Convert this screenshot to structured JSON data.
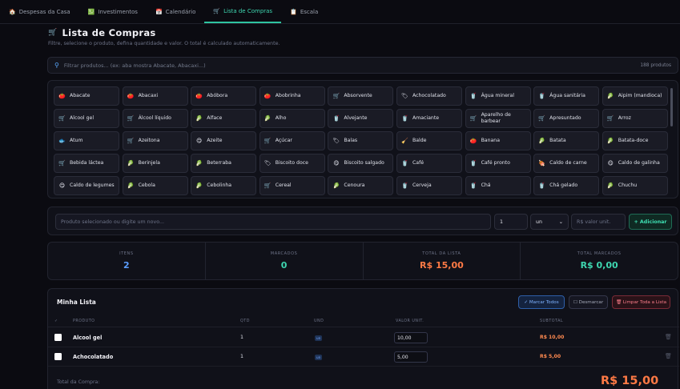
{
  "tabs": [
    {
      "icon": "🏠",
      "label": "Despesas da Casa",
      "active": false
    },
    {
      "icon": "💹",
      "label": "Investimentos",
      "active": false
    },
    {
      "icon": "📅",
      "label": "Calendário",
      "active": false
    },
    {
      "icon": "🛒",
      "label": "Lista de Compras",
      "active": true
    },
    {
      "icon": "📋",
      "label": "Escala",
      "active": false
    }
  ],
  "header": {
    "icon": "🛒",
    "title": "Lista de Compras",
    "subtitle": "Filtre, selecione o produto, defina quantidade e valor. O total é calculado automaticamente."
  },
  "search": {
    "placeholder": "Filtrar produtos... (ex: aba mostra Abacate, Abacaxi...)",
    "count": "188 produtos"
  },
  "products": [
    {
      "icon": "🍅",
      "label": "Abacate"
    },
    {
      "icon": "🍅",
      "label": "Abacaxi"
    },
    {
      "icon": "🍅",
      "label": "Abóbora"
    },
    {
      "icon": "🍅",
      "label": "Abobrinha"
    },
    {
      "icon": "🛒",
      "label": "Absorvente"
    },
    {
      "icon": "🏷",
      "label": "Achocolatado"
    },
    {
      "icon": "🥤",
      "label": "Água mineral"
    },
    {
      "icon": "🥤",
      "label": "Água sanitária"
    },
    {
      "icon": "🥬",
      "label": "Aipim (mandioca)"
    },
    {
      "icon": "🛒",
      "label": "Alcool gel"
    },
    {
      "icon": "🛒",
      "label": "Álcool líquido"
    },
    {
      "icon": "🥬",
      "label": "Alface"
    },
    {
      "icon": "🥬",
      "label": "Alho"
    },
    {
      "icon": "🥤",
      "label": "Alvejante"
    },
    {
      "icon": "🥤",
      "label": "Amaciante"
    },
    {
      "icon": "🛒",
      "label": "Aparelho de barbear"
    },
    {
      "icon": "🛒",
      "label": "Apresuntado"
    },
    {
      "icon": "🛒",
      "label": "Arroz"
    },
    {
      "icon": "🐟",
      "label": "Atum"
    },
    {
      "icon": "🛒",
      "label": "Azeitona"
    },
    {
      "icon": "😋",
      "label": "Azeite"
    },
    {
      "icon": "🛒",
      "label": "Açúcar"
    },
    {
      "icon": "🏷",
      "label": "Balas"
    },
    {
      "icon": "🧹",
      "label": "Balde"
    },
    {
      "icon": "🍅",
      "label": "Banana"
    },
    {
      "icon": "🥬",
      "label": "Batata"
    },
    {
      "icon": "🥬",
      "label": "Batata-doce"
    },
    {
      "icon": "🛒",
      "label": "Bebida láctea"
    },
    {
      "icon": "🥬",
      "label": "Berinjela"
    },
    {
      "icon": "🥬",
      "label": "Beterraba"
    },
    {
      "icon": "🏷",
      "label": "Biscoito doce"
    },
    {
      "icon": "😋",
      "label": "Biscoito salgado"
    },
    {
      "icon": "🥤",
      "label": "Café"
    },
    {
      "icon": "🥤",
      "label": "Café pronto"
    },
    {
      "icon": "🍖",
      "label": "Caldo de carne"
    },
    {
      "icon": "😋",
      "label": "Caldo de galinha"
    },
    {
      "icon": "😋",
      "label": "Caldo de legumes"
    },
    {
      "icon": "🥬",
      "label": "Cebola"
    },
    {
      "icon": "🥬",
      "label": "Cebolinha"
    },
    {
      "icon": "🛒",
      "label": "Cereal"
    },
    {
      "icon": "🥬",
      "label": "Cenoura"
    },
    {
      "icon": "🥤",
      "label": "Cerveja"
    },
    {
      "icon": "🥤",
      "label": "Chá"
    },
    {
      "icon": "🥤",
      "label": "Chá gelado"
    },
    {
      "icon": "🥬",
      "label": "Chuchu"
    },
    {
      "icon": "🛒",
      "label": ""
    },
    {
      "icon": "🛒",
      "label": ""
    },
    {
      "icon": "🛒",
      "label": ""
    },
    {
      "icon": "🛒",
      "label": ""
    },
    {
      "icon": "🛒",
      "label": ""
    },
    {
      "icon": "🛒",
      "label": ""
    },
    {
      "icon": "🛒",
      "label": ""
    },
    {
      "icon": "🛒",
      "label": ""
    },
    {
      "icon": "🛒",
      "label": ""
    }
  ],
  "add_form": {
    "product_placeholder": "Produto selecionado ou digite um novo...",
    "qty_value": "1",
    "unit_value": "un",
    "unit_arrow": "⌄",
    "price_placeholder": "R$ valor unit.",
    "add_label": "+ Adicionar"
  },
  "stats": [
    {
      "label": "ITENS",
      "value": "2",
      "color": "#5b9dff"
    },
    {
      "label": "MARCADOS",
      "value": "0",
      "color": "#3ed6b0"
    },
    {
      "label": "TOTAL DA LISTA",
      "value": "R$ 15,00",
      "color": "#ff7a45"
    },
    {
      "label": "TOTAL MARCADOS",
      "value": "R$ 0,00",
      "color": "#3ed6b0"
    }
  ],
  "list": {
    "title": "Minha Lista",
    "mark_all": "✓ Marcar Todos",
    "unmark": "☐ Desmarcar",
    "clear": "🗑 Limpar Toda a Lista",
    "columns": {
      "check": "✓",
      "product": "PRODUTO",
      "qty": "QTD",
      "unit": "UND",
      "price": "VALOR UNIT.",
      "subtotal": "SUBTOTAL"
    },
    "rows": [
      {
        "name": "Alcool gel",
        "qty": "1",
        "unit": "un",
        "price": "10,00",
        "subtotal": "R$ 10,00",
        "trash": "🗑"
      },
      {
        "name": "Achocolatado",
        "qty": "1",
        "unit": "un",
        "price": "5,00",
        "subtotal": "R$ 5,00",
        "trash": "🗑"
      }
    ],
    "total_label": "Total da Compra:",
    "total_value": "R$ 15,00"
  }
}
